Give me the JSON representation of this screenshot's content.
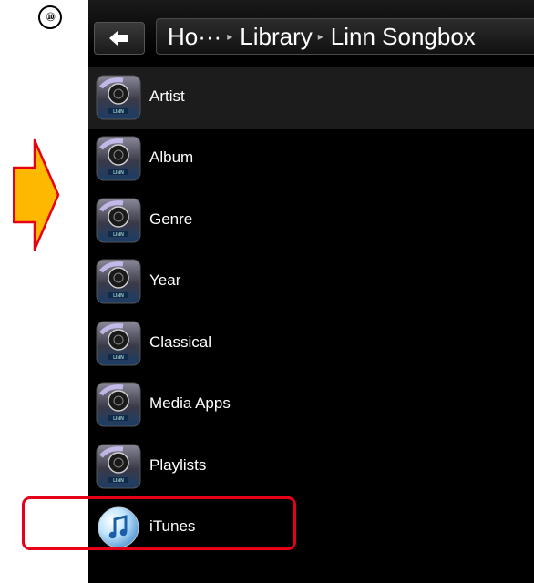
{
  "step": {
    "number": "⑩"
  },
  "header": {
    "breadcrumb": [
      "Ho···",
      "Library",
      "Linn Songbox"
    ]
  },
  "menu": {
    "items": [
      {
        "label": "Artist",
        "icon": "linn-icon"
      },
      {
        "label": "Album",
        "icon": "linn-icon"
      },
      {
        "label": "Genre",
        "icon": "linn-icon"
      },
      {
        "label": "Year",
        "icon": "linn-icon"
      },
      {
        "label": "Classical",
        "icon": "linn-icon"
      },
      {
        "label": "Media Apps",
        "icon": "linn-icon"
      },
      {
        "label": "Playlists",
        "icon": "linn-icon"
      },
      {
        "label": "iTunes",
        "icon": "itunes-icon"
      }
    ],
    "selected_index": 0
  },
  "colors": {
    "highlight": "#e6001a",
    "arrow": "#ffb800",
    "arrow_stroke": "#e60012"
  }
}
